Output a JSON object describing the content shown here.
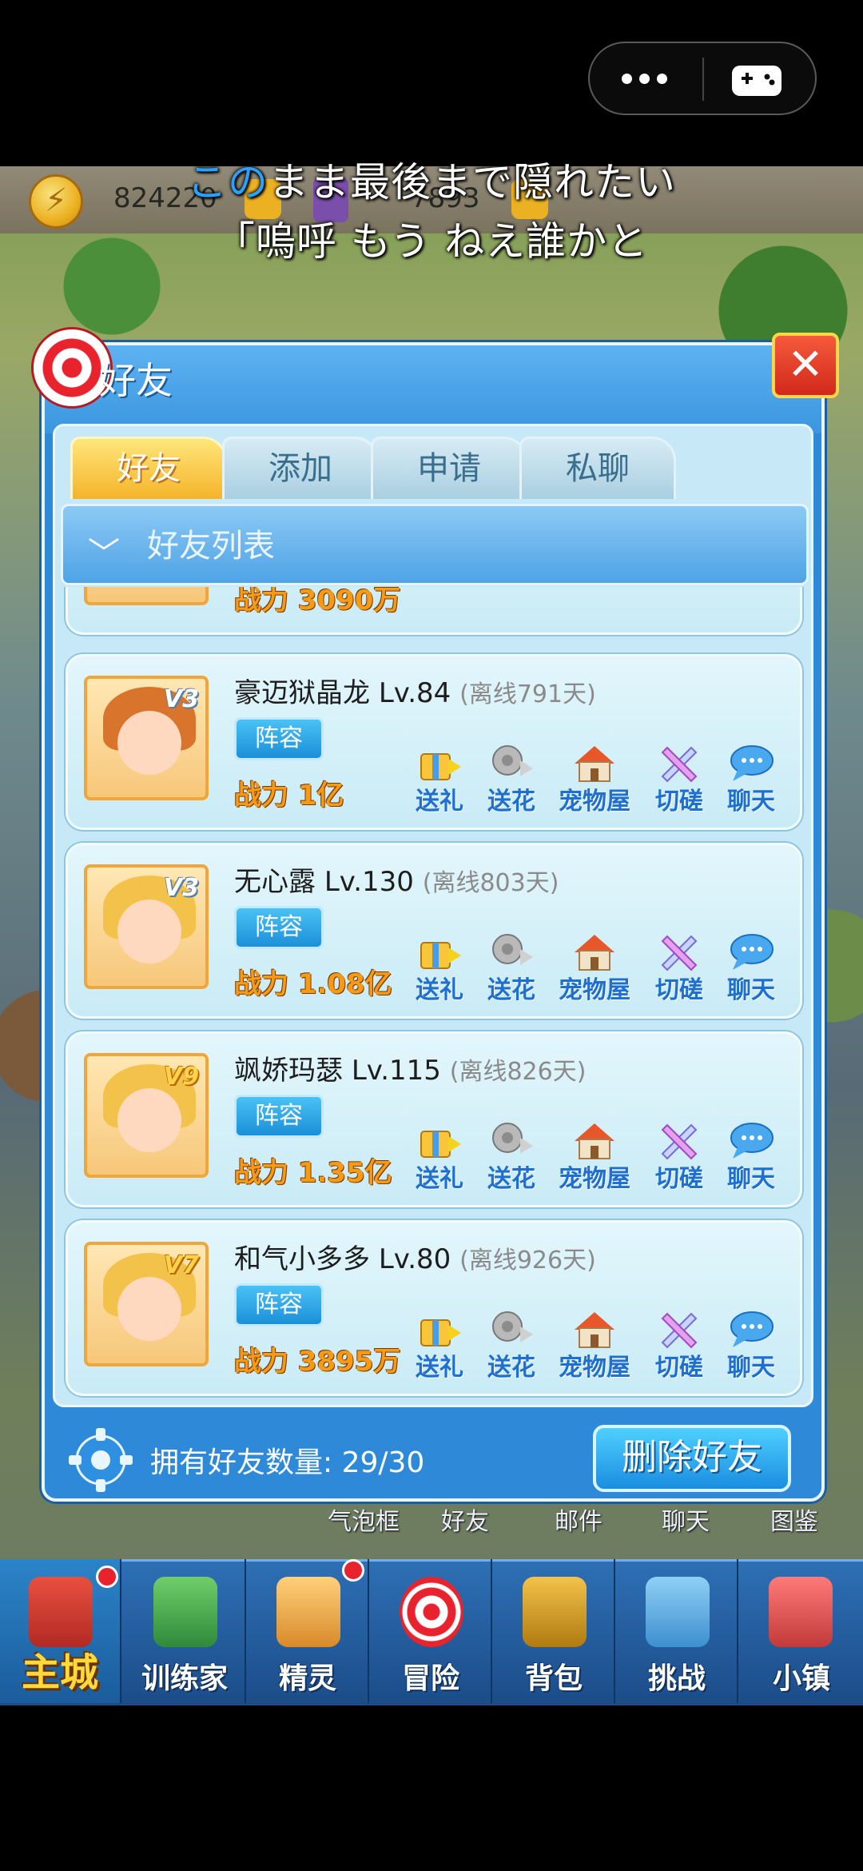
{
  "resources": {
    "coins": "824220",
    "gems": "7893"
  },
  "subtitles": {
    "line1_accent": "この",
    "line1_rest": "まま最後まで隠れたい",
    "line2": "「嗚呼 もう ねえ誰かと"
  },
  "panel": {
    "title": "好友",
    "close_label": "✕",
    "tabs": [
      {
        "label": "好友",
        "active": true
      },
      {
        "label": "添加",
        "active": false
      },
      {
        "label": "申请",
        "active": false
      },
      {
        "label": "私聊",
        "active": false
      }
    ],
    "list_title": "好友列表",
    "actions": [
      "送礼",
      "送花",
      "宠物屋",
      "切磋",
      "聊天"
    ],
    "lineup_label": "阵容",
    "friends": [
      {
        "name": "",
        "level": "",
        "offline": "",
        "power": "战力 3090万",
        "vip": ""
      },
      {
        "name": "豪迈狱晶龙",
        "level": "Lv.84",
        "offline": "(离线791天)",
        "power": "战力 1亿",
        "vip": "V3"
      },
      {
        "name": "无心露",
        "level": "Lv.130",
        "offline": "(离线803天)",
        "power": "战力 1.08亿",
        "vip": "V3"
      },
      {
        "name": "飒娇玛瑟",
        "level": "Lv.115",
        "offline": "(离线826天)",
        "power": "战力 1.35亿",
        "vip": "V9"
      },
      {
        "name": "和气小多多",
        "level": "Lv.80",
        "offline": "(离线926天)",
        "power": "战力 3895万",
        "vip": "V7"
      }
    ],
    "friend_count_label": "拥有好友数量:",
    "friend_count": "29/30",
    "delete_label": "删除好友"
  },
  "under_labels": [
    "气泡框",
    "好友",
    "邮件",
    "聊天",
    "图鉴"
  ],
  "nav": [
    {
      "label": "主城",
      "active": true
    },
    {
      "label": "训练家",
      "active": false
    },
    {
      "label": "精灵",
      "active": false
    },
    {
      "label": "冒险",
      "active": false
    },
    {
      "label": "背包",
      "active": false
    },
    {
      "label": "挑战",
      "active": false
    },
    {
      "label": "小镇",
      "active": false
    }
  ]
}
